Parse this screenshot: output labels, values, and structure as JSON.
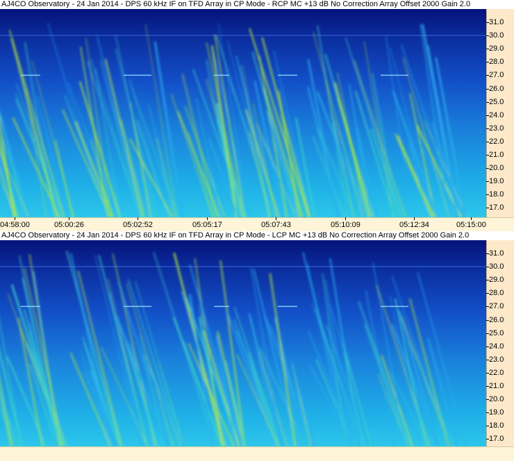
{
  "panels": [
    {
      "title": "AJ4CO Observatory - 24 Jan 2014 - DPS 60 kHz IF on TFD Array in CP Mode - RCP  MC +13 dB  No Correction Array  Offset 2000   Gain 2.0",
      "polarization": "RCP",
      "freq_ticks": [
        "31.0",
        "30.0",
        "29.0",
        "28.0",
        "27.0",
        "26.0",
        "25.0",
        "24.0",
        "23.0",
        "22.0",
        "21.0",
        "20.0",
        "19.0",
        "18.0",
        "17.0"
      ]
    },
    {
      "title": "AJ4CO Observatory - 24 Jan 2014 - DPS 60 kHz IF on TFD Array in CP Mode - LCP  MC +13 dB  No Correction Array  Offset 2000   Gain 2.0",
      "polarization": "LCP",
      "freq_ticks": [
        "31.0",
        "30.0",
        "29.0",
        "28.0",
        "27.0",
        "26.0",
        "25.0",
        "24.0",
        "23.0",
        "22.0",
        "21.0",
        "20.0",
        "19.0",
        "18.0",
        "17.0"
      ]
    }
  ],
  "time_axis": {
    "ticks": [
      "04:58:00",
      "05:00:26",
      "05:02:52",
      "05:05:17",
      "05:07:43",
      "05:10:09",
      "05:12:34",
      "05:15:00"
    ]
  },
  "colors": {
    "axis_background": "#fde9c9",
    "spectrogram_low": "#06127a",
    "spectrogram_mid": "#1a8fe0",
    "spectrogram_high": "#c8f040"
  }
}
